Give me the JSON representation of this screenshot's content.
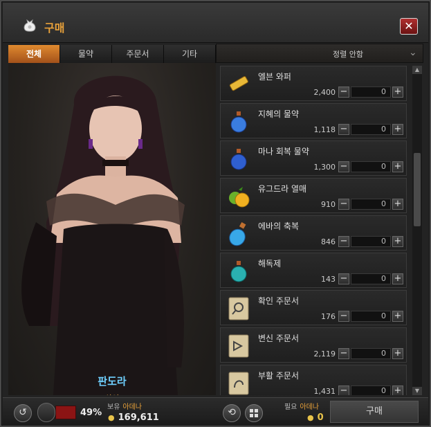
{
  "window": {
    "title": "구매",
    "close_label": "✕"
  },
  "tabs": [
    {
      "label": "전체",
      "active": true
    },
    {
      "label": "물약",
      "active": false
    },
    {
      "label": "주문서",
      "active": false
    },
    {
      "label": "기타",
      "active": false
    }
  ],
  "sort": {
    "label": "정렬 안함"
  },
  "npc": {
    "name": "판도라",
    "role": "[ 상인 ]"
  },
  "items": [
    {
      "name": "엘븐 와퍼",
      "price": "2,400",
      "qty": "0",
      "icon": "wafer-icon"
    },
    {
      "name": "지혜의 물약",
      "price": "1,118",
      "qty": "0",
      "icon": "potion-blue-icon"
    },
    {
      "name": "마나 회복 물약",
      "price": "1,300",
      "qty": "0",
      "icon": "potion-blue-icon"
    },
    {
      "name": "유그드라 열매",
      "price": "910",
      "qty": "0",
      "icon": "fruit-icon"
    },
    {
      "name": "에바의 축복",
      "price": "846",
      "qty": "0",
      "icon": "potion-cyan-icon"
    },
    {
      "name": "해독제",
      "price": "143",
      "qty": "0",
      "icon": "potion-teal-icon"
    },
    {
      "name": "확인 주문서",
      "price": "176",
      "qty": "0",
      "icon": "scroll-icon"
    },
    {
      "name": "변신 주문서",
      "price": "2,119",
      "qty": "0",
      "icon": "scroll-icon"
    },
    {
      "name": "부활 주문서",
      "price": "1,431",
      "qty": "0",
      "icon": "scroll-icon"
    }
  ],
  "bottom": {
    "weight_percent": "49%",
    "owned_label": "보유",
    "adena_label": "아데나",
    "owned_amount": "169,611",
    "needed_label": "필요",
    "needed_amount": "0",
    "buy_label": "구매"
  },
  "colors": {
    "accent": "#e8a13a",
    "tab_active": "#c86e24",
    "npc_name": "#6fd0ff"
  }
}
